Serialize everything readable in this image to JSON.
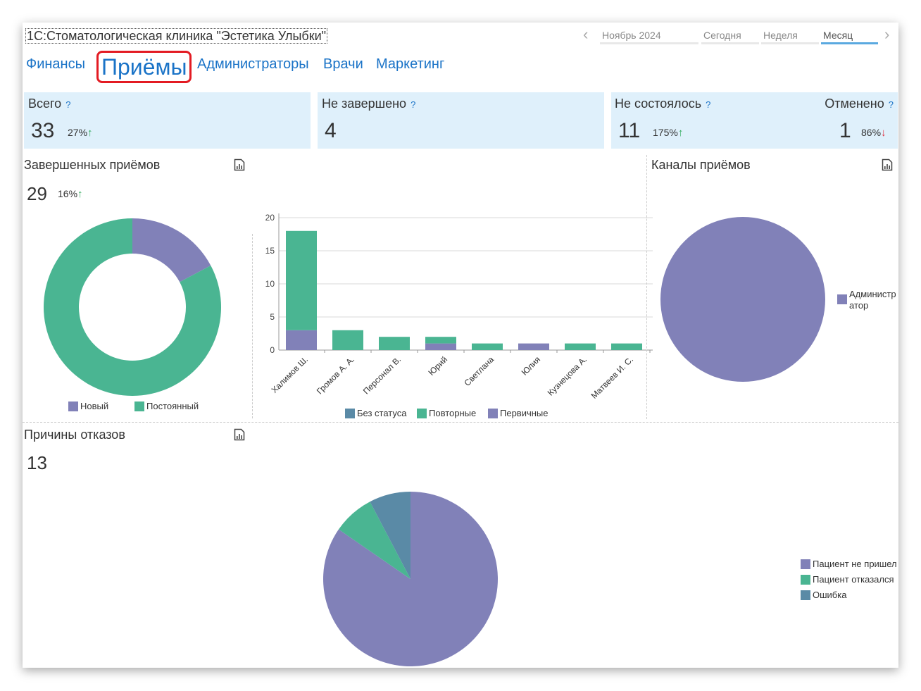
{
  "app": {
    "title": "1С:Стоматологическая клиника \"Эстетика Улыбки\""
  },
  "period": {
    "current": "Ноябрь 2024",
    "today": "Сегодня",
    "week": "Неделя",
    "month": "Месяц"
  },
  "nav": [
    "Финансы",
    "Приёмы",
    "Администраторы",
    "Врачи",
    "Маркетинг"
  ],
  "cards": {
    "total": {
      "label": "Всего",
      "value": "33",
      "pct": "27%"
    },
    "incomplete": {
      "label": "Не завершено",
      "value": "4"
    },
    "not_held": {
      "label": "Не состоялось",
      "value": "11",
      "pct": "175%"
    },
    "cancelled": {
      "label": "Отменено",
      "value": "1",
      "pct": "86%"
    }
  },
  "completed": {
    "title": "Завершенных приёмов",
    "value": "29",
    "pct": "16%"
  },
  "channels": {
    "title": "Каналы приёмов"
  },
  "reasons": {
    "title": "Причины отказов",
    "value": "13"
  },
  "colors": {
    "purple": "#8181b8",
    "green": "#4ab592",
    "steel": "#5a8aa6",
    "accent": "#1a73c7",
    "card_bg": "#dff0fb"
  },
  "chart_data": [
    {
      "type": "pie",
      "variant": "donut",
      "categories": [
        "Новый",
        "Постоянный"
      ],
      "values": [
        5,
        24
      ]
    },
    {
      "type": "bar",
      "stacked": true,
      "categories": [
        "Халимов Ш.",
        "Громов А. А.",
        "Персонал В.",
        "Юрий",
        "Светлана",
        "Юлия",
        "Кузнецова А.",
        "Матвеев И. С."
      ],
      "series": [
        {
          "name": "Без статуса",
          "values": [
            0,
            0,
            0,
            0,
            0,
            0,
            0,
            0
          ]
        },
        {
          "name": "Повторные",
          "values": [
            15,
            3,
            2,
            1,
            1,
            0,
            1,
            1
          ]
        },
        {
          "name": "Первичные",
          "values": [
            3,
            0,
            0,
            1,
            0,
            1,
            0,
            0
          ]
        }
      ],
      "yticks": [
        0,
        5,
        10,
        15,
        20
      ],
      "ylim": [
        0,
        20
      ],
      "grid": true,
      "legend": "bottom"
    },
    {
      "type": "pie",
      "categories": [
        "Администр атор"
      ],
      "values": [
        1
      ],
      "legend": "right"
    },
    {
      "type": "pie",
      "categories": [
        "Пациент не пришел",
        "Пациент отказался",
        "Ошибка"
      ],
      "values": [
        11,
        1,
        1
      ],
      "legend": "right"
    }
  ]
}
